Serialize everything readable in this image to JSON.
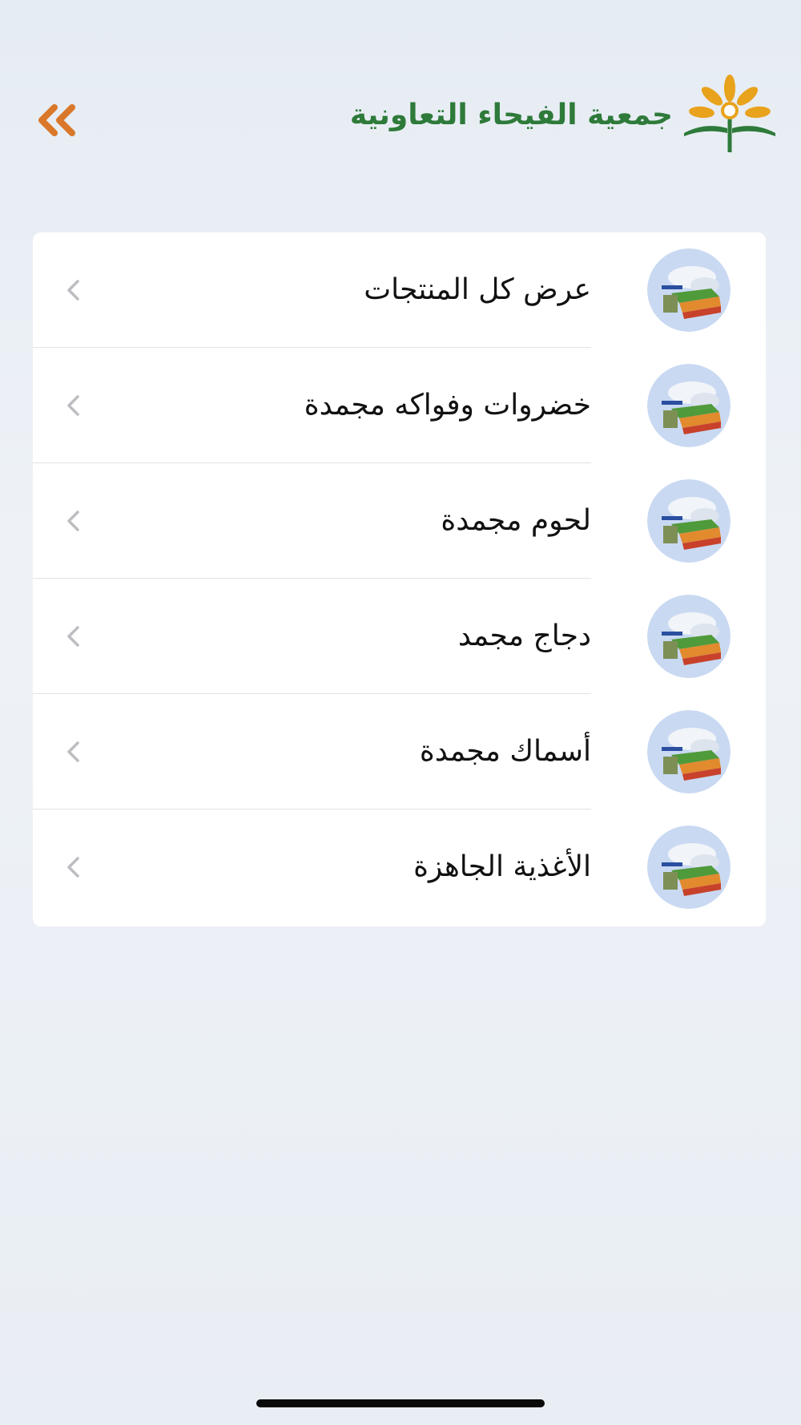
{
  "header": {
    "brand_name": "جمعية الفيحاء التعاونية",
    "back_icon": "double-chevron-left-icon",
    "back_color": "#d9782a",
    "brand_color": "#2e7a3a"
  },
  "categories": [
    {
      "label": "عرض كل المنتجات",
      "icon": "category-thumbnail-icon"
    },
    {
      "label": "خضروات وفواكه مجمدة",
      "icon": "category-thumbnail-icon"
    },
    {
      "label": "لحوم مجمدة",
      "icon": "category-thumbnail-icon"
    },
    {
      "label": "دجاج مجمد",
      "icon": "category-thumbnail-icon"
    },
    {
      "label": "أسماك مجمدة",
      "icon": "category-thumbnail-icon"
    },
    {
      "label": "الأغذية الجاهزة",
      "icon": "category-thumbnail-icon"
    }
  ],
  "row_chevron_icon": "chevron-right-icon"
}
